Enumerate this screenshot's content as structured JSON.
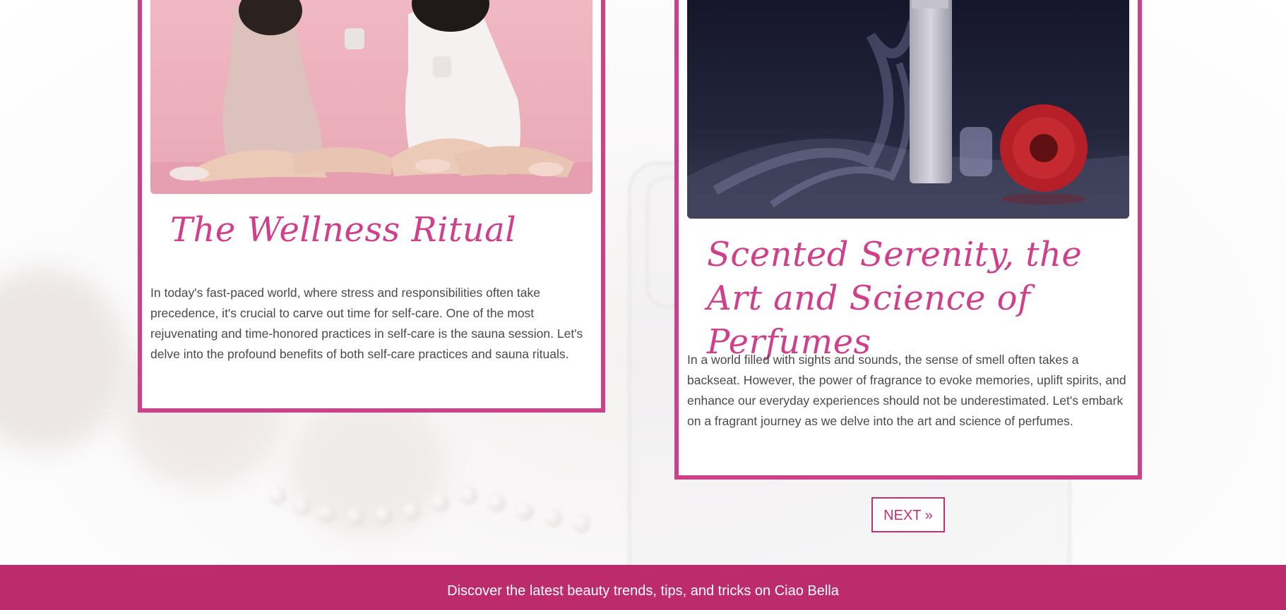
{
  "posts": [
    {
      "image_alt": "two women in robes sharing tea",
      "title": "The Wellness Ritual",
      "excerpt": "In today's fast-paced world, where stress and responsibilities often take precedence, it's crucial to carve out time for self-care. One of the most rejuvenating and time-honored practices in self-care is the sauna session. Let's delve into the profound benefits of both self-care practices and sauna rituals."
    },
    {
      "image_alt": "perfume bottle with smoke and red flower",
      "title": "Scented Serenity, the Art and Science of Perfumes",
      "excerpt": "In a world filled with sights and sounds, the sense of smell often takes a backseat. However, the power of fragrance to evoke memories, uplift spirits, and enhance our everyday experiences should not be underestimated. Let's embark on a fragrant journey as we delve into the art and science of perfumes."
    }
  ],
  "pagination": {
    "next_label": "NEXT »"
  },
  "footer": {
    "text": "Discover the latest beauty trends, tips, and tricks on Ciao Bella"
  },
  "colors": {
    "accent": "#d03f89",
    "footer_bg": "#bc2c6c",
    "body_text": "#4a4a4a"
  }
}
